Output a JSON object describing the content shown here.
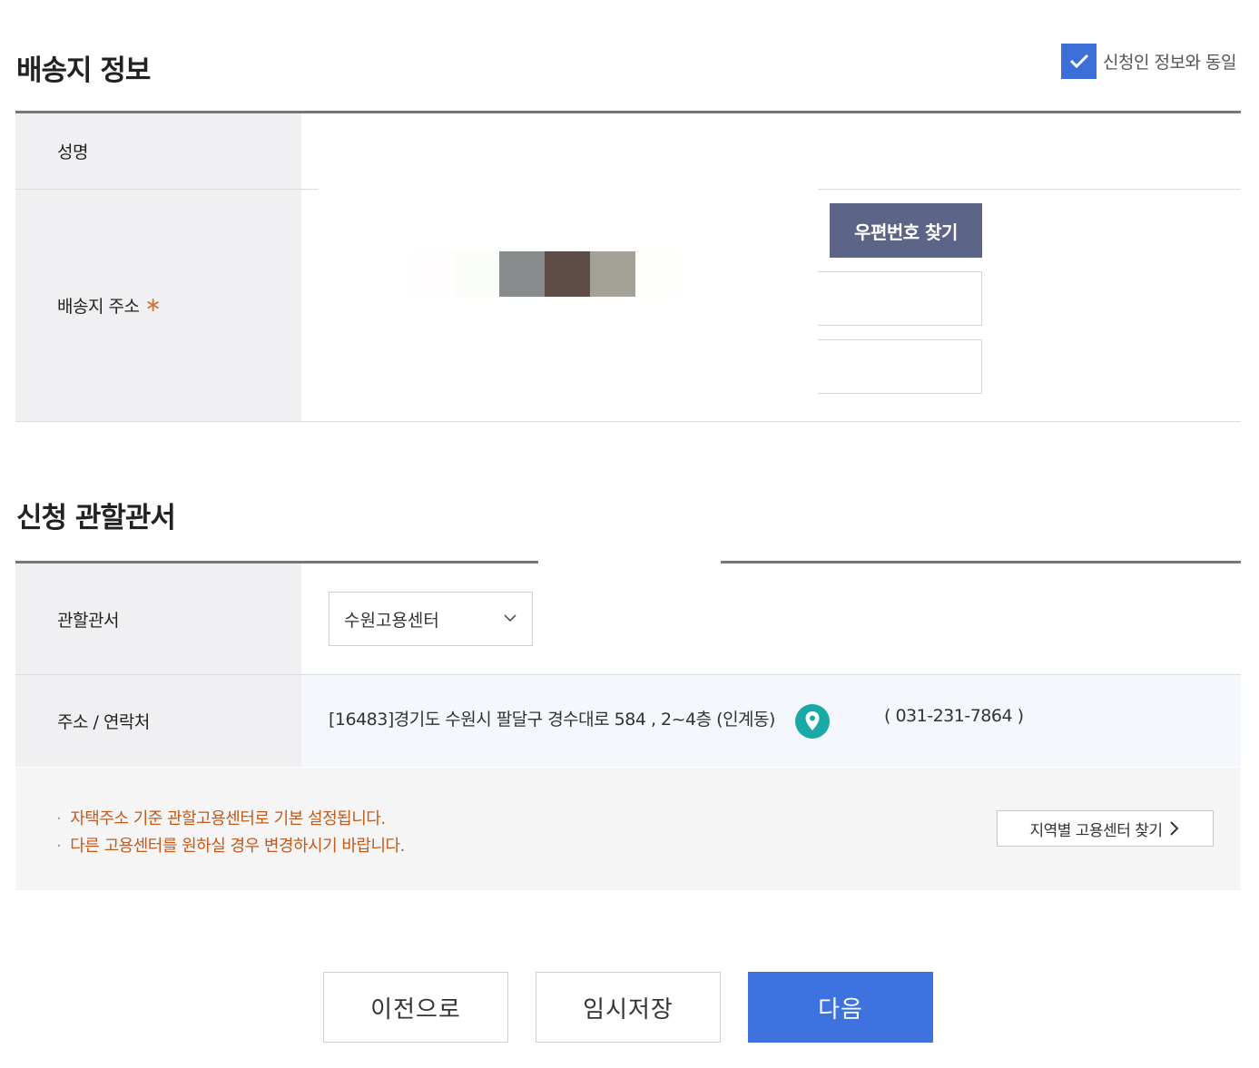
{
  "delivery": {
    "title": "배송지 정보",
    "same_as_applicant_label": "신청인 정보와 동일",
    "same_as_applicant_checked": true,
    "name_label": "성명",
    "address_label": "배송지 주소",
    "required_mark": "∗",
    "zip_button_label": "우편번호 찾기"
  },
  "office": {
    "title": "신청 관할관서",
    "office_label": "관할관서",
    "office_selected": "수원고용센터",
    "contact_label": "주소 / 연락처",
    "address": "[16483]경기도 수원시 팔달구 경수대로 584 , 2~4층 (인계동)",
    "phone": "( 031-231-7864 )",
    "notices": [
      "자택주소 기준 관할고용센터로 기본 설정됩니다.",
      "다른 고용센터를 원하실 경우 변경하시기 바랍니다."
    ],
    "region_button_label": "지역별 고용센터 찾기"
  },
  "actions": {
    "prev_label": "이전으로",
    "temp_save_label": "임시저장",
    "next_label": "다음"
  },
  "colors": {
    "accent": "#3e72de",
    "checkbox": "#3d6fd9",
    "zip_button": "#5c6488",
    "notice_text": "#c25a1c",
    "pin": "#19a9a6"
  }
}
